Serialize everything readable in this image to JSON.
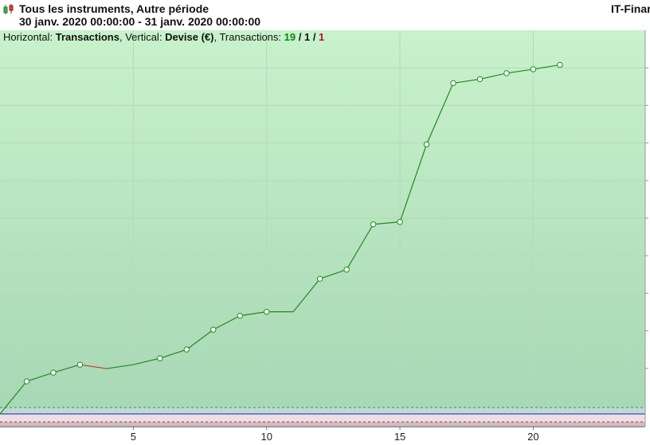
{
  "header": {
    "title": "Tous les instruments, Autre période",
    "subtitle": "30 janv. 2020 00:00:00 - 31 janv. 2020 00:00:00",
    "brand": "IT-Finar"
  },
  "infobar": {
    "horizontal_label": "Horizontal:",
    "horizontal_value": "Transactions",
    "vertical_label": ", Vertical:",
    "vertical_value": "Devise (€)",
    "transactions_label": ", Transactions:",
    "total": "19",
    "sep1": " / ",
    "neutral": "1",
    "sep2": " / ",
    "losing": "1"
  },
  "colors": {
    "line_up": "#1f8a1f",
    "line_down": "#c0392b",
    "bg_top": "#c8f2cb",
    "bg_bottom": "#a6d6b4",
    "loss_zone": "#d3bcc2",
    "zero_line": "#1a2a8a"
  },
  "chart_data": {
    "type": "line",
    "x": [
      0,
      1,
      2,
      3,
      4,
      5,
      6,
      7,
      8,
      9,
      10,
      11,
      12,
      13,
      14,
      15,
      16,
      17,
      18,
      19,
      20,
      21
    ],
    "values": [
      0,
      8.2,
      10.4,
      12.4,
      11.4,
      12.4,
      14.0,
      16.2,
      21.2,
      24.7,
      25.7,
      25.7,
      34.0,
      36.3,
      47.7,
      48.3,
      67.8,
      83.2,
      84.2,
      85.7,
      86.7,
      87.8
    ],
    "markers": [
      false,
      true,
      true,
      true,
      false,
      false,
      true,
      true,
      true,
      true,
      true,
      false,
      true,
      true,
      true,
      true,
      true,
      true,
      true,
      true,
      true,
      true
    ],
    "segment_colors": [
      "up",
      "up",
      "up",
      "down",
      "up",
      "up",
      "up",
      "up",
      "up",
      "up",
      "up",
      "up",
      "up",
      "up",
      "up",
      "up",
      "up",
      "up",
      "up",
      "up",
      "up"
    ],
    "x_ticks": [
      5,
      10,
      15,
      20
    ],
    "xlim": [
      0,
      24.2
    ],
    "ylim": [
      -3.2,
      96.5
    ],
    "grid": true
  }
}
